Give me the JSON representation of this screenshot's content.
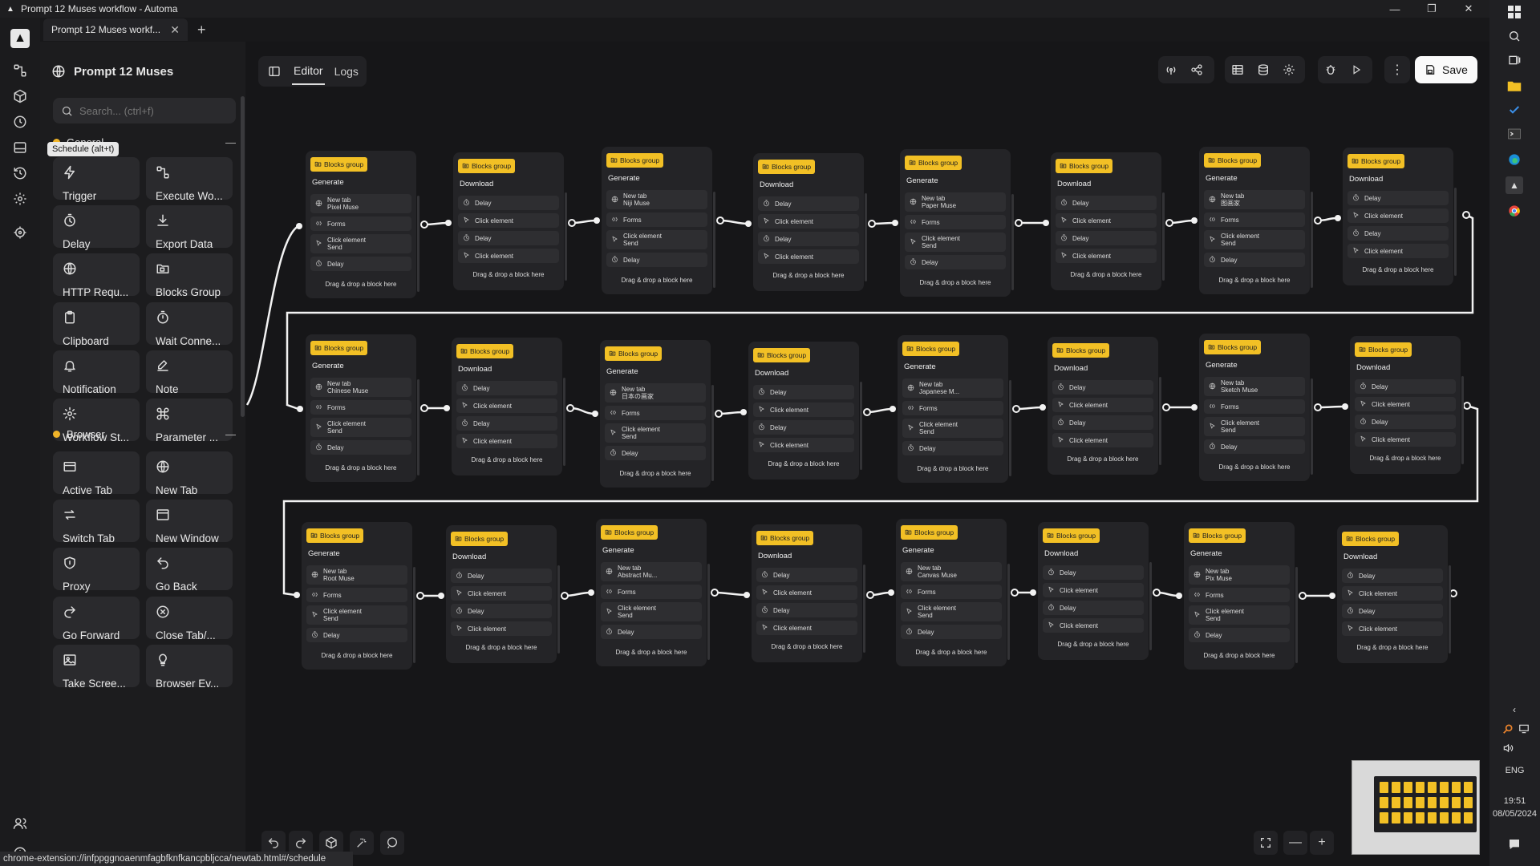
{
  "window": {
    "title": "Prompt 12 Muses workflow - Automa"
  },
  "browser_tab": {
    "label": "Prompt 12 Muses workf...",
    "new_tab": "+"
  },
  "tooltip": "Schedule (alt+t)",
  "panel": {
    "title": "Prompt 12 Muses",
    "search_placeholder": "Search... (ctrl+f)",
    "sections": [
      {
        "name": "General",
        "collapse": "—"
      },
      {
        "name": "Browser",
        "collapse": "—"
      }
    ],
    "general_blocks": [
      "Trigger",
      "Execute Wo...",
      "Delay",
      "Export Data",
      "HTTP Requ...",
      "Blocks Group",
      "Clipboard",
      "Wait Conne...",
      "Notification",
      "Note",
      "Workflow St...",
      "Parameter ..."
    ],
    "browser_blocks": [
      "Active Tab",
      "New Tab",
      "Switch Tab",
      "New Window",
      "Proxy",
      "Go Back",
      "Go Forward",
      "Close Tab/...",
      "Take Scree...",
      "Browser Ev..."
    ]
  },
  "editor": {
    "tabs": [
      "Editor",
      "Logs"
    ],
    "active_tab": "Editor",
    "save_label": "Save"
  },
  "node_text": {
    "badge": "Blocks group",
    "generate": "Generate",
    "download": "Download",
    "new_tab": "New tab",
    "forms": "Forms",
    "click": "Click element",
    "send": "Send",
    "delay": "Delay",
    "drop": "Drag & drop a block here"
  },
  "muses": [
    "Pixel Muse",
    "Niji Muse",
    "Paper Muse",
    "图画家",
    "Chinese Muse",
    "日本の画家",
    "Japanese M...",
    "Sketch Muse",
    "Root Muse",
    "Abstract Mu...",
    "Canvas Muse",
    "Pix Muse"
  ],
  "statusbar": "chrome-extension://infppggnoaenmfagbfknfkancpbljcca/newtab.html#/schedule",
  "taskbar": {
    "lang": "ENG",
    "time": "19:51",
    "date": "08/05/2024"
  }
}
